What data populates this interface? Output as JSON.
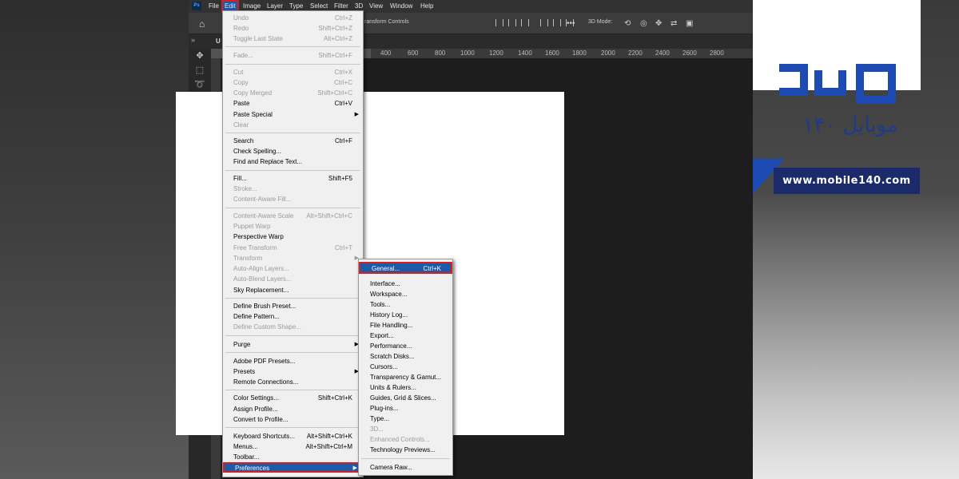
{
  "app": {
    "logo_text": "Ps",
    "tab_label": "U"
  },
  "menubar": [
    "File",
    "Edit",
    "Image",
    "Layer",
    "Type",
    "Select",
    "Filter",
    "3D",
    "View",
    "Window",
    "Help"
  ],
  "options_bar": {
    "transform_text": "ransform Controls",
    "mode_3d": "3D Mode:"
  },
  "ruler_labels": [
    "400",
    "600",
    "800",
    "1000",
    "1200",
    "1400",
    "1600",
    "1800",
    "2000",
    "2200",
    "2400",
    "2600",
    "2800"
  ],
  "edit_menu": {
    "items": [
      {
        "label": "Undo",
        "shortcut": "Ctrl+Z",
        "disabled": true
      },
      {
        "label": "Redo",
        "shortcut": "Shift+Ctrl+Z",
        "disabled": true
      },
      {
        "label": "Toggle Last State",
        "shortcut": "Alt+Ctrl+Z",
        "disabled": true
      },
      {
        "label": "Fade...",
        "shortcut": "Shift+Ctrl+F",
        "disabled": true
      },
      {
        "label": "Cut",
        "shortcut": "Ctrl+X",
        "disabled": true
      },
      {
        "label": "Copy",
        "shortcut": "Ctrl+C",
        "disabled": true
      },
      {
        "label": "Copy Merged",
        "shortcut": "Shift+Ctrl+C",
        "disabled": true
      },
      {
        "label": "Paste",
        "shortcut": "Ctrl+V",
        "disabled": false
      },
      {
        "label": "Paste Special",
        "shortcut": "",
        "disabled": false,
        "submenu": true
      },
      {
        "label": "Clear",
        "shortcut": "",
        "disabled": true
      },
      {
        "label": "Search",
        "shortcut": "Ctrl+F",
        "disabled": false
      },
      {
        "label": "Check Spelling...",
        "shortcut": "",
        "disabled": false
      },
      {
        "label": "Find and Replace Text...",
        "shortcut": "",
        "disabled": false
      },
      {
        "label": "Fill...",
        "shortcut": "Shift+F5",
        "disabled": false
      },
      {
        "label": "Stroke...",
        "shortcut": "",
        "disabled": true
      },
      {
        "label": "Content-Aware Fill...",
        "shortcut": "",
        "disabled": true
      },
      {
        "label": "Content-Aware Scale",
        "shortcut": "Alt+Shift+Ctrl+C",
        "disabled": true
      },
      {
        "label": "Puppet Warp",
        "shortcut": "",
        "disabled": true
      },
      {
        "label": "Perspective Warp",
        "shortcut": "",
        "disabled": false
      },
      {
        "label": "Free Transform",
        "shortcut": "Ctrl+T",
        "disabled": true
      },
      {
        "label": "Transform",
        "shortcut": "",
        "disabled": true,
        "submenu": true
      },
      {
        "label": "Auto-Align Layers...",
        "shortcut": "",
        "disabled": true
      },
      {
        "label": "Auto-Blend Layers...",
        "shortcut": "",
        "disabled": true
      },
      {
        "label": "Sky Replacement...",
        "shortcut": "",
        "disabled": false
      },
      {
        "label": "Define Brush Preset...",
        "shortcut": "",
        "disabled": false
      },
      {
        "label": "Define Pattern...",
        "shortcut": "",
        "disabled": false
      },
      {
        "label": "Define Custom Shape...",
        "shortcut": "",
        "disabled": true
      },
      {
        "label": "Purge",
        "shortcut": "",
        "disabled": false,
        "submenu": true
      },
      {
        "label": "Adobe PDF Presets...",
        "shortcut": "",
        "disabled": false
      },
      {
        "label": "Presets",
        "shortcut": "",
        "disabled": false,
        "submenu": true
      },
      {
        "label": "Remote Connections...",
        "shortcut": "",
        "disabled": false
      },
      {
        "label": "Color Settings...",
        "shortcut": "Shift+Ctrl+K",
        "disabled": false
      },
      {
        "label": "Assign Profile...",
        "shortcut": "",
        "disabled": false
      },
      {
        "label": "Convert to Profile...",
        "shortcut": "",
        "disabled": false
      },
      {
        "label": "Keyboard Shortcuts...",
        "shortcut": "Alt+Shift+Ctrl+K",
        "disabled": false
      },
      {
        "label": "Menus...",
        "shortcut": "Alt+Shift+Ctrl+M",
        "disabled": false
      },
      {
        "label": "Toolbar...",
        "shortcut": "",
        "disabled": false
      },
      {
        "label": "Preferences",
        "shortcut": "",
        "disabled": false,
        "submenu": true,
        "highlighted": true
      }
    ]
  },
  "preferences_submenu": {
    "items": [
      {
        "label": "General...",
        "shortcut": "Ctrl+K",
        "highlighted": true
      },
      {
        "label": "Interface...",
        "disabled": false
      },
      {
        "label": "Workspace...",
        "disabled": false
      },
      {
        "label": "Tools...",
        "disabled": false
      },
      {
        "label": "History Log...",
        "disabled": false
      },
      {
        "label": "File Handling...",
        "disabled": false
      },
      {
        "label": "Export...",
        "disabled": false
      },
      {
        "label": "Performance...",
        "disabled": false
      },
      {
        "label": "Scratch Disks...",
        "disabled": false
      },
      {
        "label": "Cursors...",
        "disabled": false
      },
      {
        "label": "Transparency & Gamut...",
        "disabled": false
      },
      {
        "label": "Units & Rulers...",
        "disabled": false
      },
      {
        "label": "Guides, Grid & Slices...",
        "disabled": false
      },
      {
        "label": "Plug-ins...",
        "disabled": false
      },
      {
        "label": "Type...",
        "disabled": false
      },
      {
        "label": "3D...",
        "disabled": true
      },
      {
        "label": "Enhanced Controls...",
        "disabled": true
      },
      {
        "label": "Technology Previews...",
        "disabled": false
      },
      {
        "label": "Camera Raw...",
        "disabled": false
      }
    ]
  },
  "brand": {
    "persian_name": "موبایل ۱۴۰",
    "url": "www.mobile140.com",
    "color": "#1d4bb3"
  }
}
